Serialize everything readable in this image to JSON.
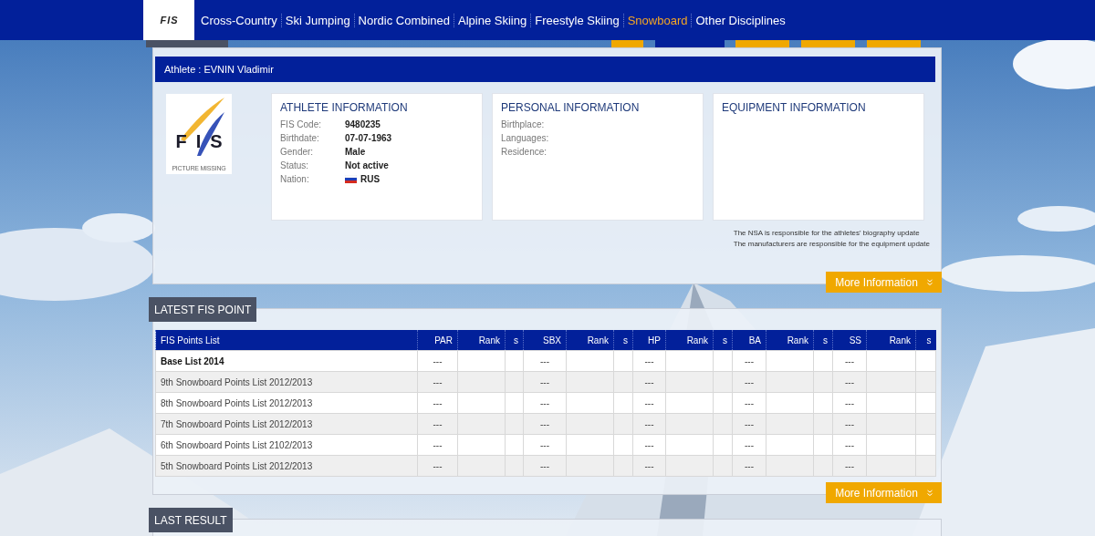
{
  "nav": {
    "logo_letters": [
      "F",
      "I",
      "S"
    ],
    "items": [
      {
        "label": "Cross-Country",
        "selected": false
      },
      {
        "label": "Ski Jumping",
        "selected": false
      },
      {
        "label": "Nordic Combined",
        "selected": false
      },
      {
        "label": "Alpine Skiing",
        "selected": false
      },
      {
        "label": "Freestyle Skiing",
        "selected": false
      },
      {
        "label": "Snowboard",
        "selected": true
      },
      {
        "label": "Other Disciplines",
        "selected": false
      }
    ]
  },
  "toolbar": [
    {
      "kind": "icon"
    },
    {
      "kind": "dark"
    },
    {
      "kind": "plain"
    },
    {
      "kind": "plain"
    },
    {
      "kind": "plain"
    }
  ],
  "athlete": {
    "header": "Athlete : EVNIN Vladimir",
    "photo": {
      "letters": [
        "F",
        "I",
        "S"
      ],
      "caption": "PICTURE MISSING"
    },
    "cards": [
      {
        "title": "ATHLETE INFORMATION",
        "fields": [
          {
            "label": "FIS Code:",
            "value": "9480235"
          },
          {
            "label": "Birthdate:",
            "value": "07-07-1963"
          },
          {
            "label": "Gender:",
            "value": "Male"
          },
          {
            "label": "Status:",
            "value": "Not active"
          },
          {
            "label": "Nation:",
            "value": "RUS",
            "flag": true
          }
        ]
      },
      {
        "title": "PERSONAL INFORMATION",
        "fields": [
          {
            "label": "Birthplace:"
          },
          {
            "label": "Languages:"
          },
          {
            "label": "Residence:"
          }
        ]
      },
      {
        "title": "EQUIPMENT INFORMATION"
      }
    ],
    "notes": [
      "The NSA is responsible for the athletes' biography update",
      "The manufacturers are responsible for the equipment update"
    ],
    "more": "More Information"
  },
  "points": {
    "title": "LATEST FIS POINT",
    "columns": [
      "FIS Points List",
      "PAR",
      "Rank",
      "s",
      "SBX",
      "Rank",
      "s",
      "HP",
      "Rank",
      "s",
      "BA",
      "Rank",
      "s",
      "SS",
      "Rank",
      "s"
    ],
    "rows": [
      {
        "kind": "base",
        "name": "Base List 2014",
        "points": [
          "---",
          "---",
          "---",
          "---",
          "---"
        ]
      },
      {
        "kind": "list",
        "name": "9th Snowboard Points List 2012/2013",
        "points": [
          "---",
          "---",
          "---",
          "---",
          "---"
        ]
      },
      {
        "kind": "list",
        "name": "8th Snowboard Points List 2012/2013",
        "points": [
          "---",
          "---",
          "---",
          "---",
          "---"
        ]
      },
      {
        "kind": "list",
        "name": "7th Snowboard Points List 2012/2013",
        "points": [
          "---",
          "---",
          "---",
          "---",
          "---"
        ]
      },
      {
        "kind": "list",
        "name": "6th Snowboard Points List 2102/2013",
        "points": [
          "---",
          "---",
          "---",
          "---",
          "---"
        ]
      },
      {
        "kind": "list",
        "name": "5th Snowboard Points List 2012/2013",
        "points": [
          "---",
          "---",
          "---",
          "---",
          "---"
        ]
      }
    ],
    "more": "More Information"
  },
  "last_result": {
    "title": "LAST RESULT"
  }
}
